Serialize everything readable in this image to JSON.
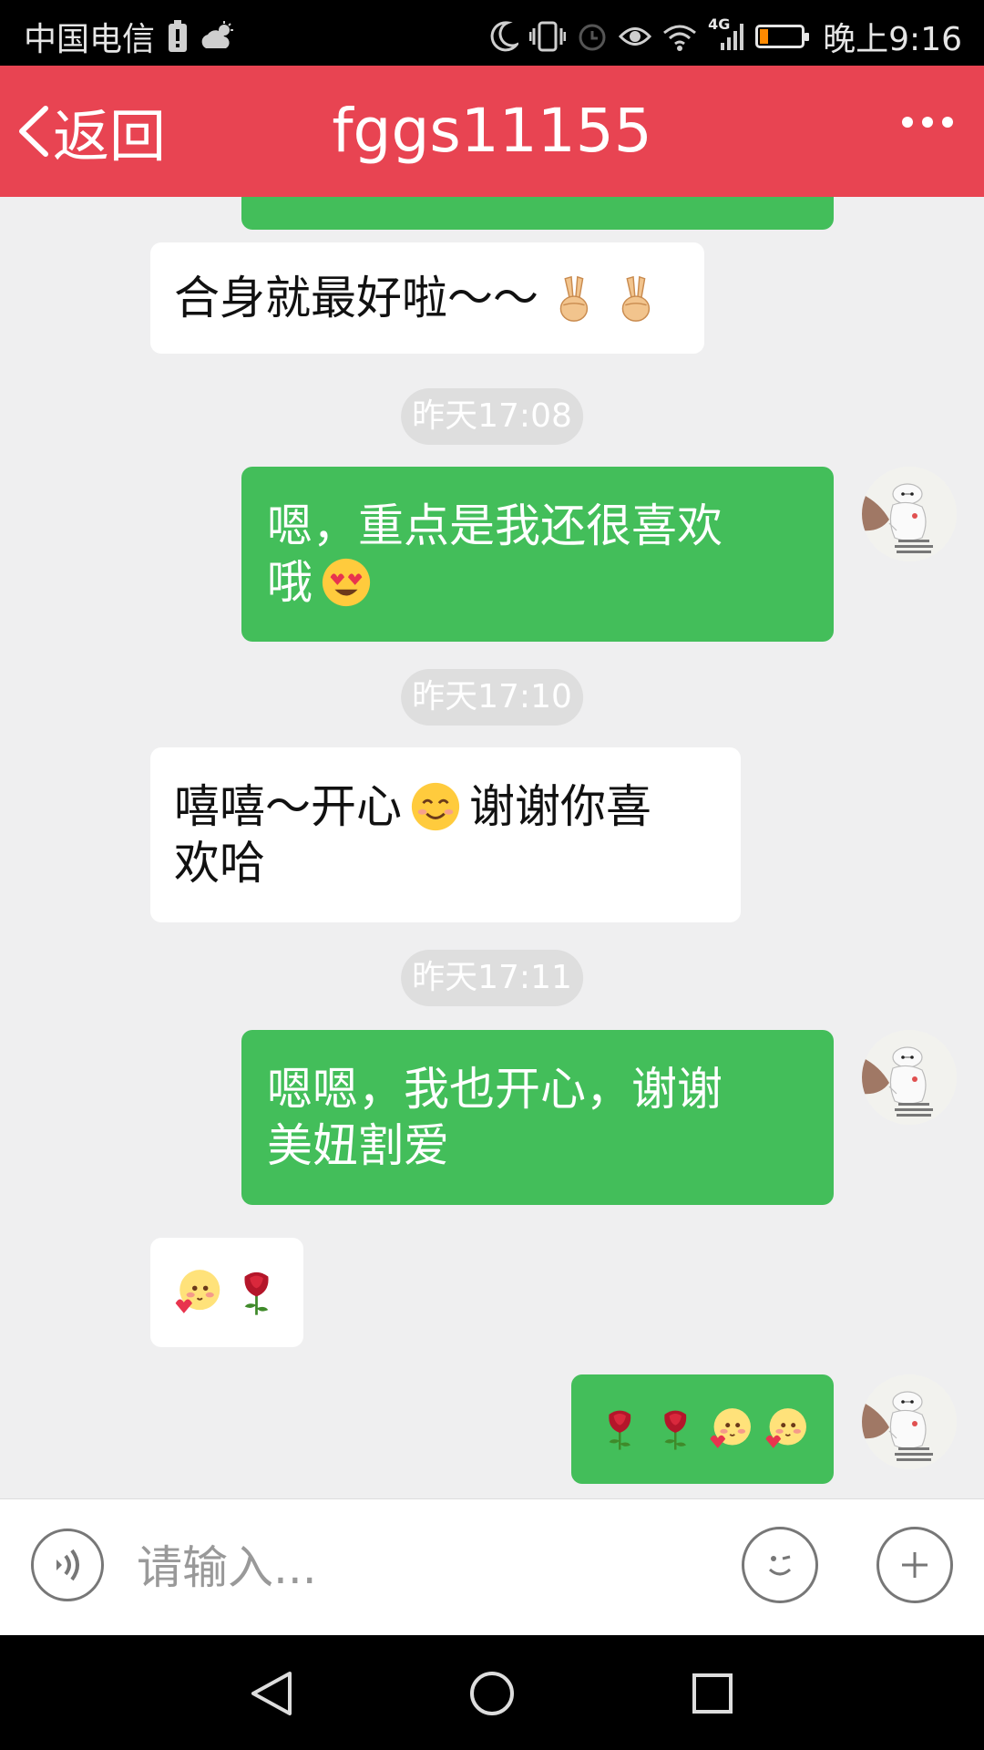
{
  "status_bar": {
    "carrier": "中国电信",
    "time": "晚上9:16",
    "network": "4G",
    "battery_level": 0.2,
    "icons": [
      "battery-saver-icon",
      "weather-icon",
      "moon-icon",
      "vibrate-icon",
      "alarm-icon",
      "eye-icon",
      "wifi-icon",
      "signal-icon",
      "battery-icon"
    ]
  },
  "header": {
    "back_label": "返回",
    "title": "fggs11155",
    "more_icon": "more-icon"
  },
  "messages": [
    {
      "side": "in",
      "text": "合身就最好啦～～",
      "emojis": [
        "victory-hand",
        "victory-hand"
      ]
    },
    {
      "type": "timestamp",
      "text": "昨天17:08"
    },
    {
      "side": "out",
      "line1": "嗯，重点是我还很喜欢",
      "line2": "哦",
      "emojis": [
        "heart-eyes"
      ]
    },
    {
      "type": "timestamp",
      "text": "昨天17:10"
    },
    {
      "side": "in",
      "part1": "嘻嘻～开心",
      "part2": "谢谢你喜",
      "line2": "欢哈",
      "emojis": [
        "smile"
      ]
    },
    {
      "type": "timestamp",
      "text": "昨天17:11"
    },
    {
      "side": "out",
      "line1": "嗯嗯，我也开心，谢谢",
      "line2": "美妞割爱"
    },
    {
      "side": "in",
      "emojis": [
        "blush-heart",
        "rose"
      ]
    },
    {
      "side": "out",
      "emojis": [
        "rose",
        "rose",
        "blush-heart",
        "blush-heart"
      ]
    }
  ],
  "input_bar": {
    "placeholder": "请输入...",
    "voice_icon": "voice-icon",
    "emoji_icon": "emoji-icon",
    "plus_icon": "plus-icon"
  },
  "nav_bar": {
    "icons": [
      "back-icon",
      "home-icon",
      "recents-icon"
    ]
  },
  "colors": {
    "header": "#e84452",
    "outgoing_bubble": "#43be5a",
    "incoming_bubble": "#ffffff",
    "chat_background": "#efeff0"
  }
}
